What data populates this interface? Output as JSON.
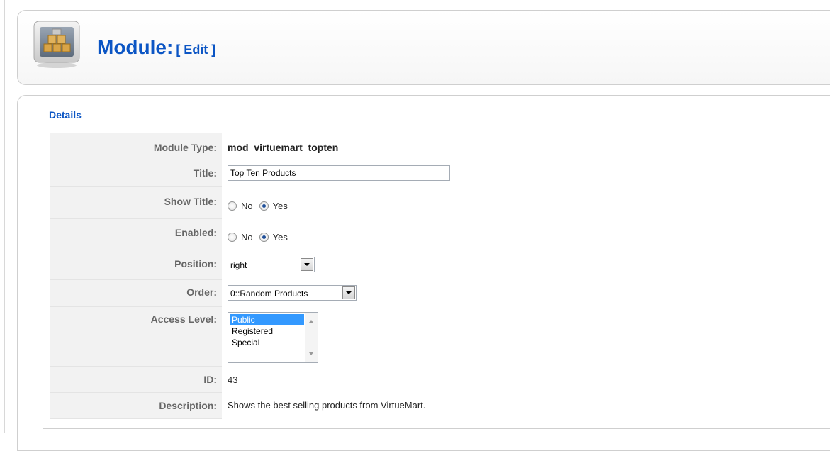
{
  "header": {
    "icon": "module-box-icon",
    "title": "Module:",
    "edit_tag": "[ Edit ]"
  },
  "details": {
    "legend": "Details",
    "module_type": {
      "label": "Module Type:",
      "value": "mod_virtuemart_topten"
    },
    "title": {
      "label": "Title:",
      "value": "Top Ten Products"
    },
    "show_title": {
      "label": "Show Title:",
      "options": [
        "No",
        "Yes"
      ],
      "selected": "Yes"
    },
    "enabled": {
      "label": "Enabled:",
      "options": [
        "No",
        "Yes"
      ],
      "selected": "Yes"
    },
    "position": {
      "label": "Position:",
      "value": "right"
    },
    "order": {
      "label": "Order:",
      "value": "0::Random Products"
    },
    "access_level": {
      "label": "Access Level:",
      "options": [
        "Public",
        "Registered",
        "Special"
      ],
      "selected": "Public"
    },
    "id": {
      "label": "ID:",
      "value": "43"
    },
    "description": {
      "label": "Description:",
      "value": "Shows the best selling products from VirtueMart."
    }
  },
  "colors": {
    "heading": "#0b55c4",
    "label_bg": "#f2f2f2",
    "selection": "#3399ff"
  }
}
